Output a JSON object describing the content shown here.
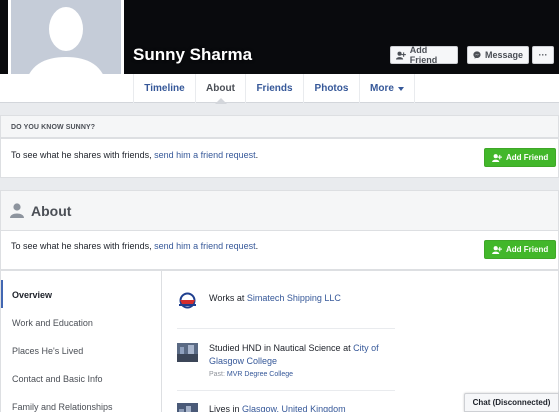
{
  "profile": {
    "name": "Sunny Sharma"
  },
  "cover_actions": {
    "add_friend_label": "Add Friend",
    "message_label": "Message",
    "more_label": "···"
  },
  "tabs": [
    {
      "label": "Timeline",
      "active": false
    },
    {
      "label": "About",
      "active": true
    },
    {
      "label": "Friends",
      "active": false
    },
    {
      "label": "Photos",
      "active": false
    },
    {
      "label": "More",
      "active": false
    }
  ],
  "know": {
    "heading": "DO YOU KNOW SUNNY?",
    "text_prefix": "To see what he shares with friends, ",
    "link": "send him a friend request",
    "text_suffix": ".",
    "button_label": "Add Friend"
  },
  "about": {
    "title": "About",
    "text_prefix": "To see what he shares with friends, ",
    "link": "send him a friend request",
    "text_suffix": ".",
    "button_label": "Add Friend",
    "nav": [
      {
        "label": "Overview",
        "active": true
      },
      {
        "label": "Work and Education",
        "active": false
      },
      {
        "label": "Places He's Lived",
        "active": false
      },
      {
        "label": "Contact and Basic Info",
        "active": false
      },
      {
        "label": "Family and Relationships",
        "active": false
      }
    ],
    "work": {
      "prefix": "Works at ",
      "link": "Simatech Shipping LLC"
    },
    "education": {
      "prefix": "Studied HND in Nautical Science at ",
      "link": "City of Glasgow College",
      "past_prefix": "Past: ",
      "past_link": "MVR Degree College"
    },
    "lives": {
      "prefix": "Lives in ",
      "link": "Glasgow, United Kingdom"
    }
  },
  "chat": {
    "label": "Chat (Disconnected)"
  },
  "colors": {
    "cover": "#090a0d",
    "link": "#365899",
    "green": "#42b72a",
    "active_nav": "#4267b2"
  },
  "icons": [
    "default-avatar-icon",
    "add-friend-icon",
    "messenger-icon",
    "more-icon",
    "user-silhouette-icon",
    "company-logo-icon",
    "college-image-icon"
  ]
}
